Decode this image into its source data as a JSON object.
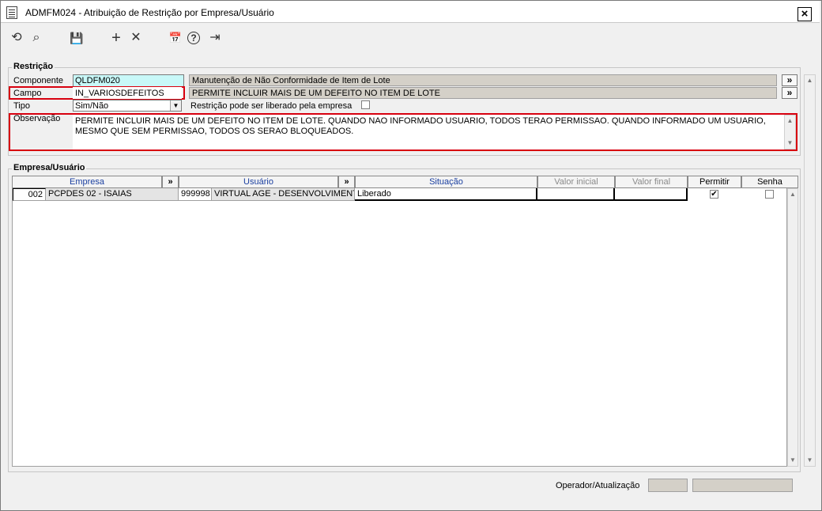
{
  "window": {
    "title": "ADMFM024 - Atribuição de Restrição por Empresa/Usuário",
    "close_label": "×"
  },
  "toolbar": {
    "refresh": "⟲",
    "search": "⌕",
    "save": "💾",
    "add": "+",
    "delete": "✕",
    "calendar": "📅",
    "help": "?",
    "exit": "⇥"
  },
  "restricao": {
    "title": "Restrição",
    "componente_label": "Componente",
    "componente_value": "QLDFM020",
    "componente_desc": "Manutenção de Não Conformidade de Item de Lote",
    "campo_label": "Campo",
    "campo_value": "IN_VARIOSDEFEITOS",
    "campo_desc": "PERMITE INCLUIR MAIS DE UM DEFEITO NO ITEM DE LOTE",
    "tipo_label": "Tipo",
    "tipo_value": "Sim/Não",
    "liberado_label": "Restrição pode ser liberado pela empresa",
    "liberado_checked": false,
    "observacao_label": "Observação",
    "observacao_value": "PERMITE INCLUIR MAIS DE UM DEFEITO NO ITEM DE LOTE. QUANDO NAO INFORMADO USUARIO, TODOS TERAO PERMISSAO. QUANDO INFORMADO UM USUARIO, MESMO QUE SEM PERMISSAO, TODOS OS SERAO BLOQUEADOS.",
    "lookup_symbol": "»"
  },
  "empresa_usuario": {
    "title": "Empresa/Usuário",
    "columns": {
      "empresa": "Empresa",
      "usuario": "Usuário",
      "situacao": "Situação",
      "valor_inicial": "Valor inicial",
      "valor_final": "Valor final",
      "permitir": "Permitir",
      "senha": "Senha"
    },
    "rows": [
      {
        "empresa_cod": "002",
        "empresa_nome": "PCPDES 02 - ISAIAS",
        "usuario_cod": "999998",
        "usuario_nome": "VIRTUAL AGE - DESENVOLVIMENTO",
        "situacao": "Liberado",
        "valor_inicial": "",
        "valor_final": "",
        "permitir": true,
        "senha": false
      }
    ]
  },
  "footer": {
    "operador_label": "Operador/Atualização",
    "operador_value": "",
    "atualizacao_value": ""
  },
  "colors": {
    "highlight_border": "#d8000f",
    "input_focus": "#c8f8f8",
    "header_text": "#1a3fa0"
  }
}
